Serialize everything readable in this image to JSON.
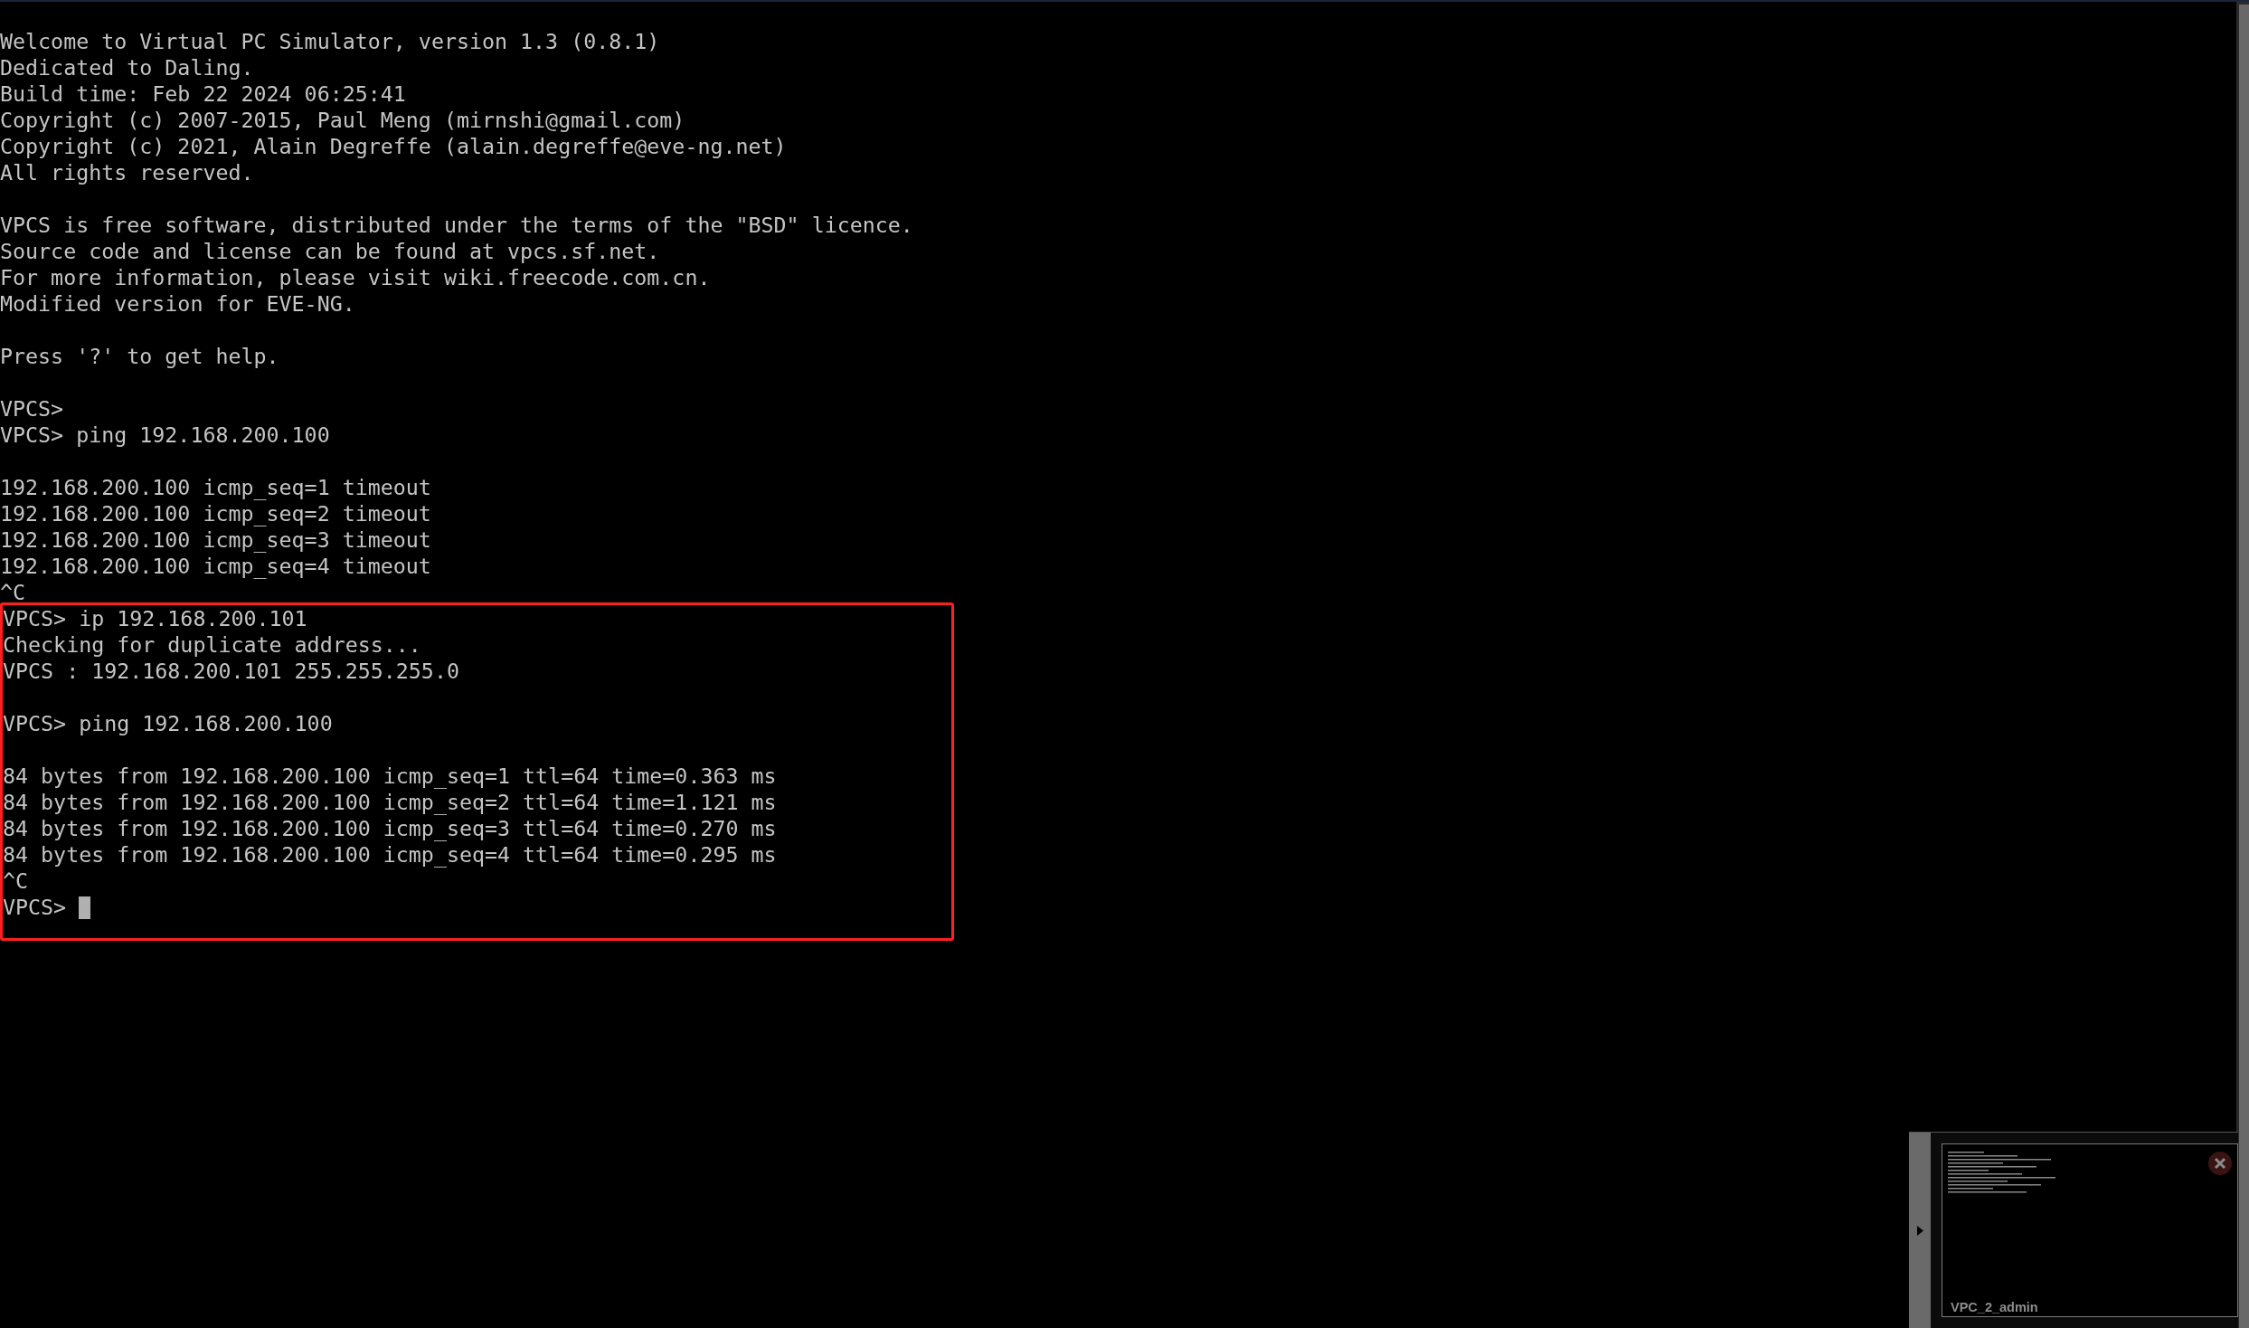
{
  "terminal": {
    "sections": [
      {
        "highlighted": false,
        "blocks": [
          [
            "Welcome to Virtual PC Simulator, version 1.3 (0.8.1)",
            "Dedicated to Daling.",
            "Build time: Feb 22 2024 06:25:41",
            "Copyright (c) 2007-2015, Paul Meng (mirnshi@gmail.com)",
            "Copyright (c) 2021, Alain Degreffe (alain.degreffe@eve-ng.net)",
            "All rights reserved."
          ],
          [
            "VPCS is free software, distributed under the terms of the \"BSD\" licence.",
            "Source code and license can be found at vpcs.sf.net.",
            "For more information, please visit wiki.freecode.com.cn.",
            "Modified version for EVE-NG."
          ],
          [
            "Press '?' to get help."
          ],
          [
            "VPCS>",
            "VPCS> ping 192.168.200.100"
          ],
          [
            "192.168.200.100 icmp_seq=1 timeout",
            "192.168.200.100 icmp_seq=2 timeout",
            "192.168.200.100 icmp_seq=3 timeout",
            "192.168.200.100 icmp_seq=4 timeout",
            "^C"
          ]
        ]
      },
      {
        "highlighted": true,
        "blocks": [
          [
            "VPCS> ip 192.168.200.101",
            "Checking for duplicate address...",
            "VPCS : 192.168.200.101 255.255.255.0"
          ],
          [
            "VPCS> ping 192.168.200.100"
          ],
          [
            "84 bytes from 192.168.200.100 icmp_seq=1 ttl=64 time=0.363 ms",
            "84 bytes from 192.168.200.100 icmp_seq=2 ttl=64 time=1.121 ms",
            "84 bytes from 192.168.200.100 icmp_seq=3 ttl=64 time=0.270 ms",
            "84 bytes from 192.168.200.100 icmp_seq=4 ttl=64 time=0.295 ms",
            "^C"
          ]
        ],
        "prompt": {
          "text": "VPCS>",
          "cursor": true
        }
      }
    ]
  },
  "thumbnail": {
    "label": "VPC_2_admin"
  }
}
